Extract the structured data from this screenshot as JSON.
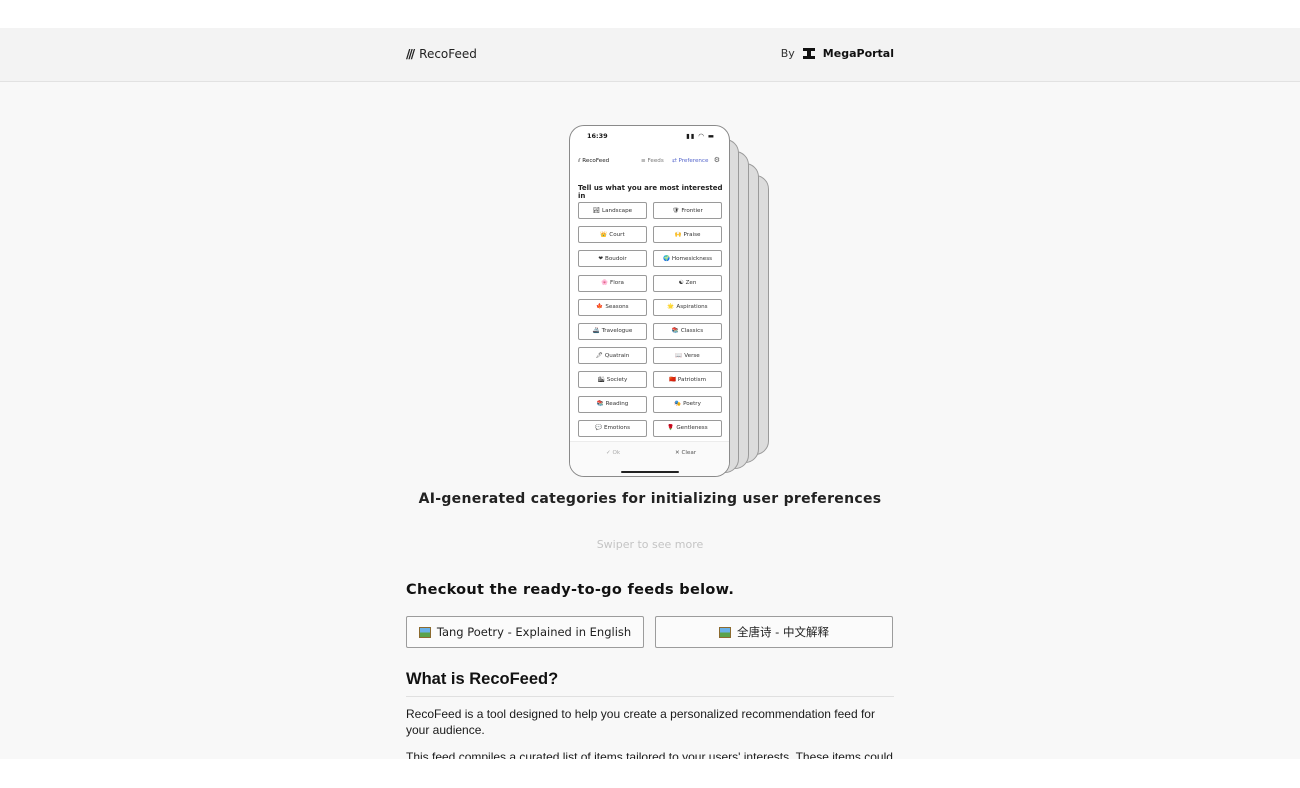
{
  "header": {
    "brand_icon": "///",
    "brand_name": "RecoFeed",
    "by_label": "By",
    "by_name": "MegaPortal"
  },
  "phone": {
    "time": "16:39",
    "status_icons": "▮▮ ◠ ▬",
    "nav": {
      "brand": "RecoFeed",
      "feeds": "Feeds",
      "preference": "Preference",
      "settings_icon": "⚙"
    },
    "prompt": "Tell us what you are most interested in",
    "chips": [
      {
        "emoji": "🏞",
        "label": "Landscape"
      },
      {
        "emoji": "🛡",
        "label": "Frontier"
      },
      {
        "emoji": "👑",
        "label": "Court"
      },
      {
        "emoji": "🙌",
        "label": "Praise"
      },
      {
        "emoji": "❤",
        "label": "Boudoir"
      },
      {
        "emoji": "🌍",
        "label": "Homesickness"
      },
      {
        "emoji": "🌸",
        "label": "Flora"
      },
      {
        "emoji": "☯",
        "label": "Zen"
      },
      {
        "emoji": "🍁",
        "label": "Seasons"
      },
      {
        "emoji": "🌟",
        "label": "Aspirations"
      },
      {
        "emoji": "🚢",
        "label": "Travelogue"
      },
      {
        "emoji": "📚",
        "label": "Classics"
      },
      {
        "emoji": "🖊",
        "label": "Quatrain"
      },
      {
        "emoji": "📖",
        "label": "Verse"
      },
      {
        "emoji": "🏙",
        "label": "Society"
      },
      {
        "emoji": "🇨🇳",
        "label": "Patriotism"
      },
      {
        "emoji": "📚",
        "label": "Reading"
      },
      {
        "emoji": "🎭",
        "label": "Poetry"
      },
      {
        "emoji": "💬",
        "label": "Emotions"
      },
      {
        "emoji": "🌹",
        "label": "Gentleness"
      }
    ],
    "ok_label": "Ok",
    "clear_label": "Clear"
  },
  "caption": "AI-generated categories for initializing user preferences",
  "swiper_hint": "Swiper to see more",
  "checkout_heading": "Checkout the ready-to-go feeds below.",
  "feeds": [
    {
      "label": "Tang Poetry - Explained in English"
    },
    {
      "label": "全唐诗 - 中文解释"
    }
  ],
  "about": {
    "heading": "What is RecoFeed?",
    "paragraph_1": "RecoFeed is a tool designed to help you create a personalized recommendation feed for your audience.",
    "paragraph_2": "This feed compiles a curated list of items tailored to your users' interests. These items could range"
  }
}
